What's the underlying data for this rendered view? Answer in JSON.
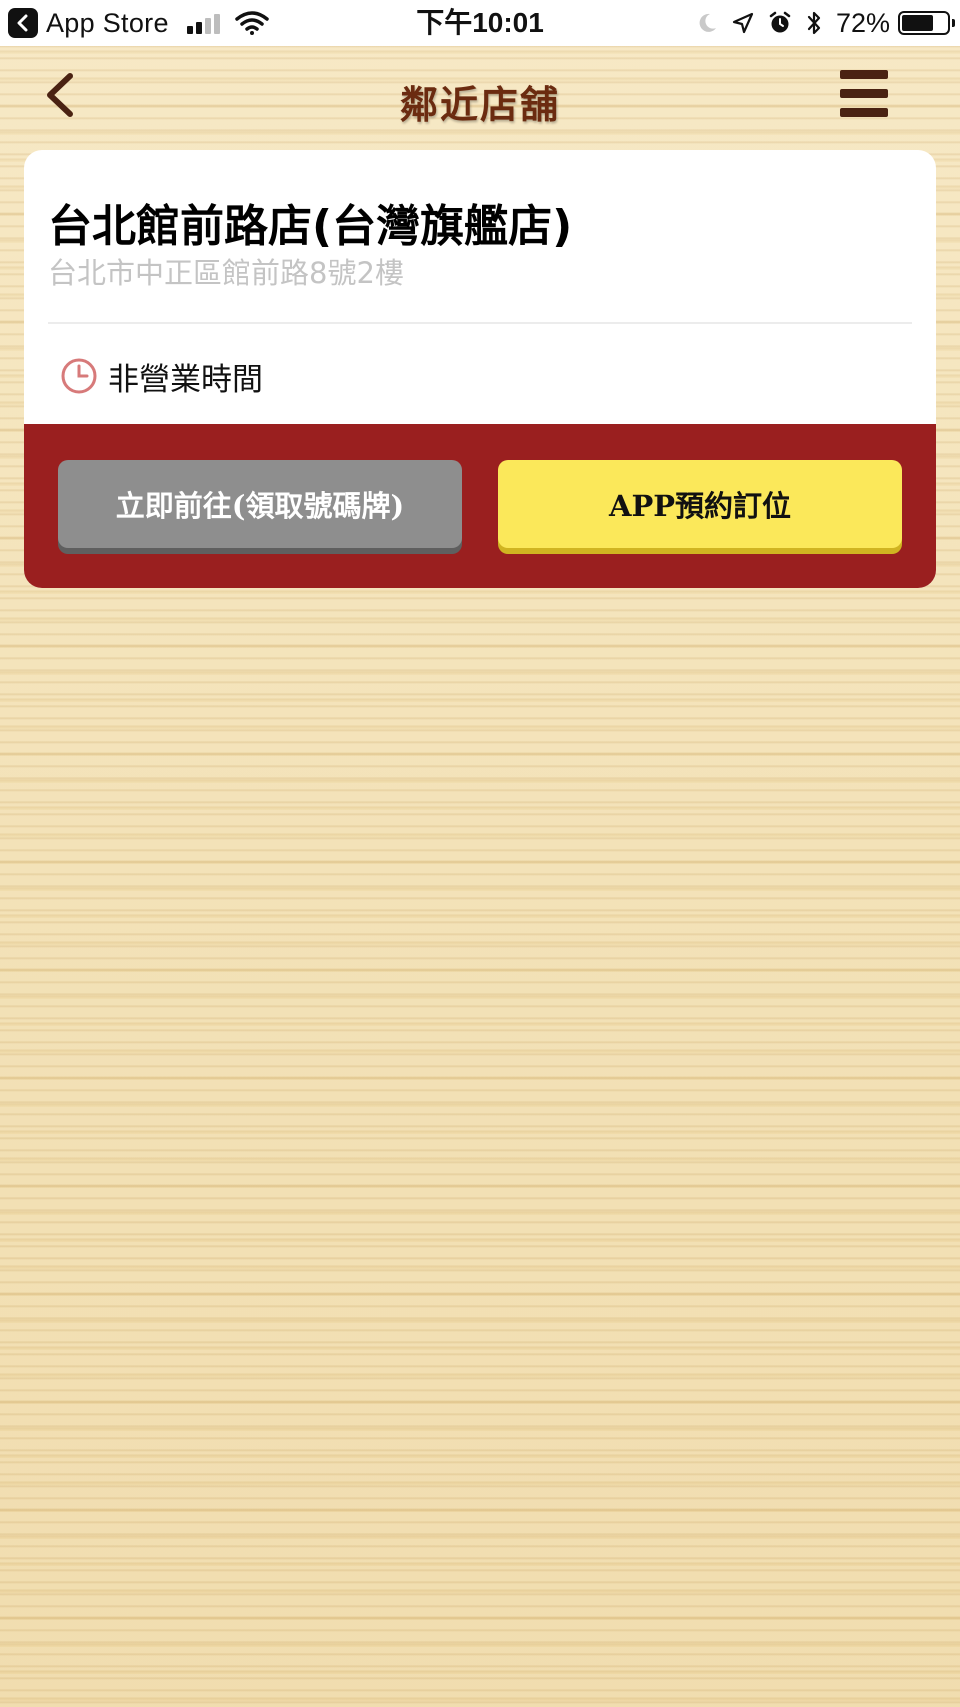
{
  "status_bar": {
    "back_app_label": "App Store",
    "time": "下午10:01",
    "battery_percent_label": "72%",
    "battery_level": 0.72,
    "icons": [
      "chevron-left-icon",
      "signal-icon",
      "wifi-icon",
      "moon-icon",
      "location-arrow-icon",
      "alarm-icon",
      "bluetooth-icon",
      "battery-icon"
    ]
  },
  "nav": {
    "title": "鄰近店舖",
    "back_icon": "chevron-left-icon",
    "menu_icon": "hamburger-menu-icon"
  },
  "store": {
    "name": "台北館前路店(台灣旗艦店)",
    "address": "台北市中正區館前路8號2樓",
    "hours_status": "非營業時間",
    "hours_icon": "clock-icon"
  },
  "actions": {
    "go_now_label": "立即前往(領取號碼牌)",
    "book_label": "APP預約訂位"
  },
  "colors": {
    "action_bar": "#9a1f1f",
    "go_button": "#8e8e8e",
    "book_button": "#fbe85a",
    "title_brown": "#6b2b10",
    "clock_red": "#d77a7a"
  }
}
